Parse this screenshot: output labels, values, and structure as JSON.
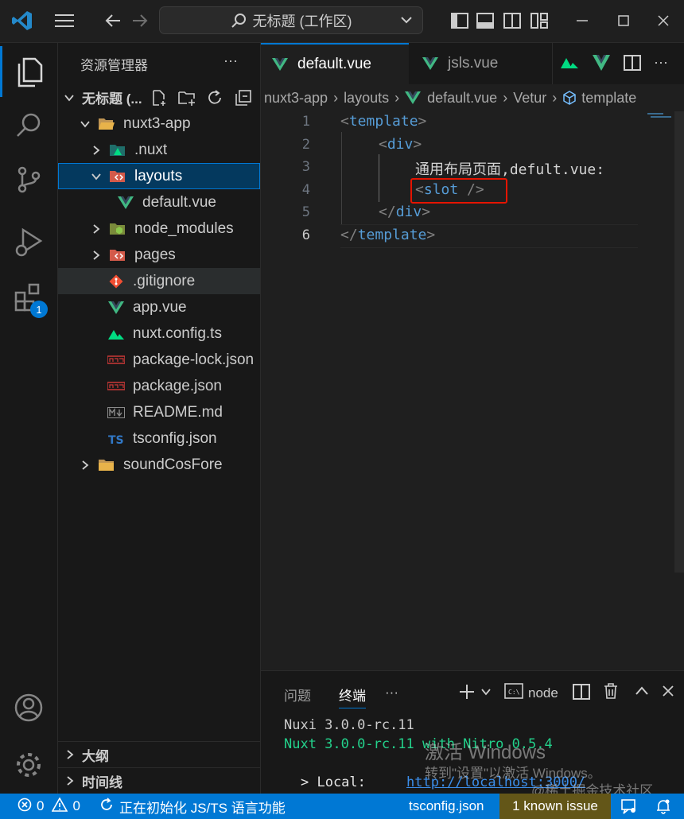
{
  "titlebar": {
    "search_text": "无标题 (工作区)"
  },
  "activity": {
    "extensions_badge": "1"
  },
  "sidebar": {
    "title": "资源管理器",
    "more": "···",
    "workspace_label": "无标题 (...",
    "tree": [
      {
        "label": "nuxt3-app",
        "icon": "folder-open-icon"
      },
      {
        "label": ".nuxt",
        "icon": "nuxt-folder-icon"
      },
      {
        "label": "layouts",
        "icon": "layout-folder-icon"
      },
      {
        "label": "default.vue",
        "icon": "vue-icon"
      },
      {
        "label": "node_modules",
        "icon": "node-folder-icon"
      },
      {
        "label": "pages",
        "icon": "pages-folder-icon"
      },
      {
        "label": ".gitignore",
        "icon": "git-icon"
      },
      {
        "label": "app.vue",
        "icon": "vue-icon"
      },
      {
        "label": "nuxt.config.ts",
        "icon": "nuxt-icon"
      },
      {
        "label": "package-lock.json",
        "icon": "npm-icon"
      },
      {
        "label": "package.json",
        "icon": "npm-icon"
      },
      {
        "label": "README.md",
        "icon": "markdown-icon"
      },
      {
        "label": "tsconfig.json",
        "icon": "ts-icon"
      },
      {
        "label": "soundCosFore",
        "icon": "folder-icon"
      }
    ],
    "outline_label": "大纲",
    "timeline_label": "时间线"
  },
  "tabs": [
    {
      "label": "default.vue",
      "active": true
    },
    {
      "label": "jsls.vue",
      "active": false
    }
  ],
  "toolbar_more": "···",
  "breadcrumb": [
    "nuxt3-app",
    "layouts",
    "default.vue",
    "Vetur",
    "template"
  ],
  "editor": {
    "lines": [
      {
        "n": "1",
        "parts": [
          {
            "t": "<",
            "c": "punct"
          },
          {
            "t": "template",
            "c": "tag"
          },
          {
            "t": ">",
            "c": "punct"
          }
        ]
      },
      {
        "n": "2",
        "parts": [
          {
            "t": "<",
            "c": "punct"
          },
          {
            "t": "div",
            "c": "tag"
          },
          {
            "t": ">",
            "c": "punct"
          }
        ]
      },
      {
        "n": "3",
        "parts": [
          {
            "t": "通用布局页面,defult.vue:",
            "c": "txt"
          }
        ]
      },
      {
        "n": "4",
        "parts": [
          {
            "t": "<",
            "c": "punct"
          },
          {
            "t": "slot",
            "c": "tag"
          },
          {
            "t": " />",
            "c": "punct"
          }
        ]
      },
      {
        "n": "5",
        "parts": [
          {
            "t": "</",
            "c": "punct"
          },
          {
            "t": "div",
            "c": "tag"
          },
          {
            "t": ">",
            "c": "punct"
          }
        ]
      },
      {
        "n": "6",
        "parts": [
          {
            "t": "</",
            "c": "punct"
          },
          {
            "t": "template",
            "c": "tag"
          },
          {
            "t": ">",
            "c": "punct"
          }
        ]
      }
    ]
  },
  "panel": {
    "tab_problems": "问题",
    "tab_terminal": "终端",
    "more": "···",
    "terminal_name": "node",
    "terminal_lines": [
      {
        "text": "Nuxi 3.0.0-rc.11",
        "color": "#cccccc"
      },
      {
        "text": "Nuxt 3.0.0-rc.11 with Nitro 0.5.4",
        "color": "#23d18b"
      }
    ],
    "local_label": "> Local:",
    "local_url": "http://localhost:3000/"
  },
  "statusbar": {
    "errors": "0",
    "warnings": "0",
    "init_text": "正在初始化 JS/TS 语言功能",
    "file": "tsconfig.json",
    "issues": "1 known issue"
  },
  "watermark": {
    "line1": "激活 Windows",
    "line2": "转到\"设置\"以激活 Windows。",
    "line3": "@稀土掘金技术社区"
  },
  "colors": {
    "accent": "#0078d4",
    "vue_green": "#41b883",
    "highlight_box": "#e51400"
  }
}
